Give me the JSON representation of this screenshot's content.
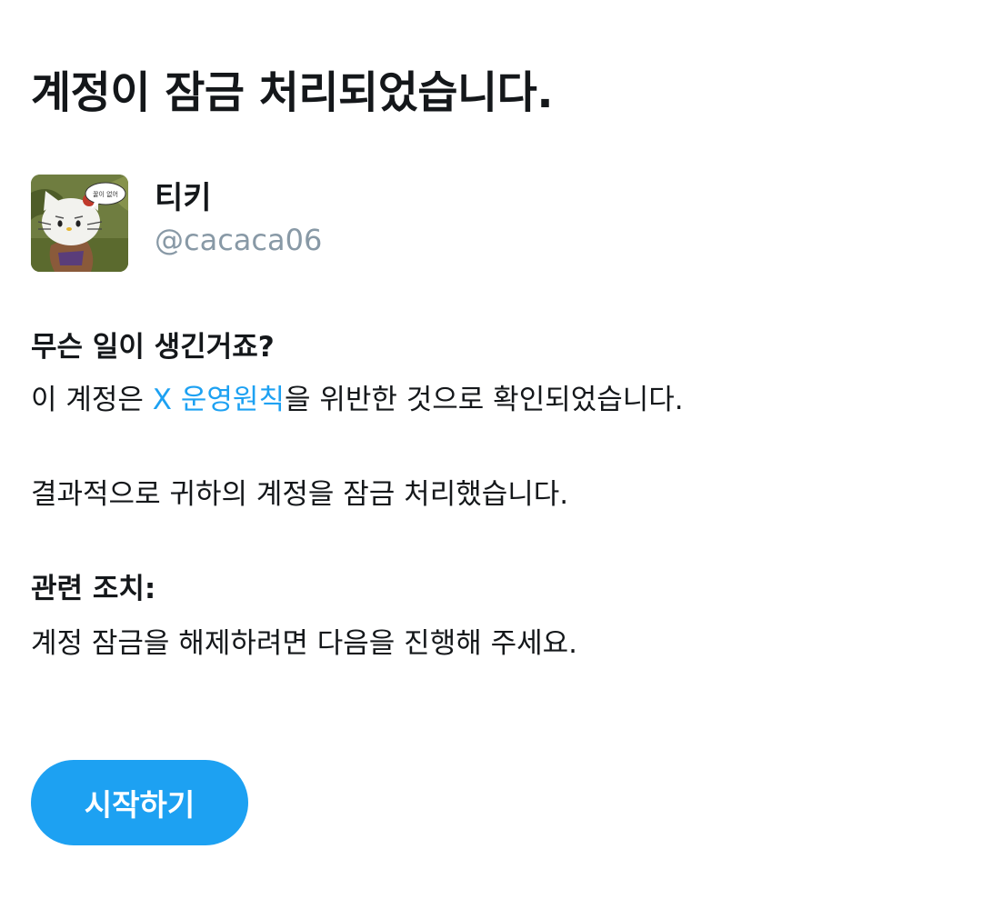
{
  "title": "계정이 잠금 처리되었습니다.",
  "profile": {
    "display_name": "티키",
    "handle": "@cacaca06",
    "avatar_icon": "hello-kitty-avatar",
    "avatar_bubble_text": "꿀이 없어"
  },
  "what_happened": {
    "heading": "무슨 일이 생긴거죠?",
    "violation_prefix": "이 계정은 ",
    "violation_link": "X 운영원칙",
    "violation_suffix": "을 위반한 것으로 확인되었습니다.",
    "result": "결과적으로 귀하의 계정을 잠금 처리했습니다."
  },
  "related_action": {
    "heading": "관련 조치:",
    "description": "계정 잠금을 해제하려면 다음을 진행해 주세요."
  },
  "start_button": {
    "label": "시작하기"
  },
  "colors": {
    "accent": "#1da1f2",
    "text": "#14171a",
    "muted": "#8899a6"
  }
}
